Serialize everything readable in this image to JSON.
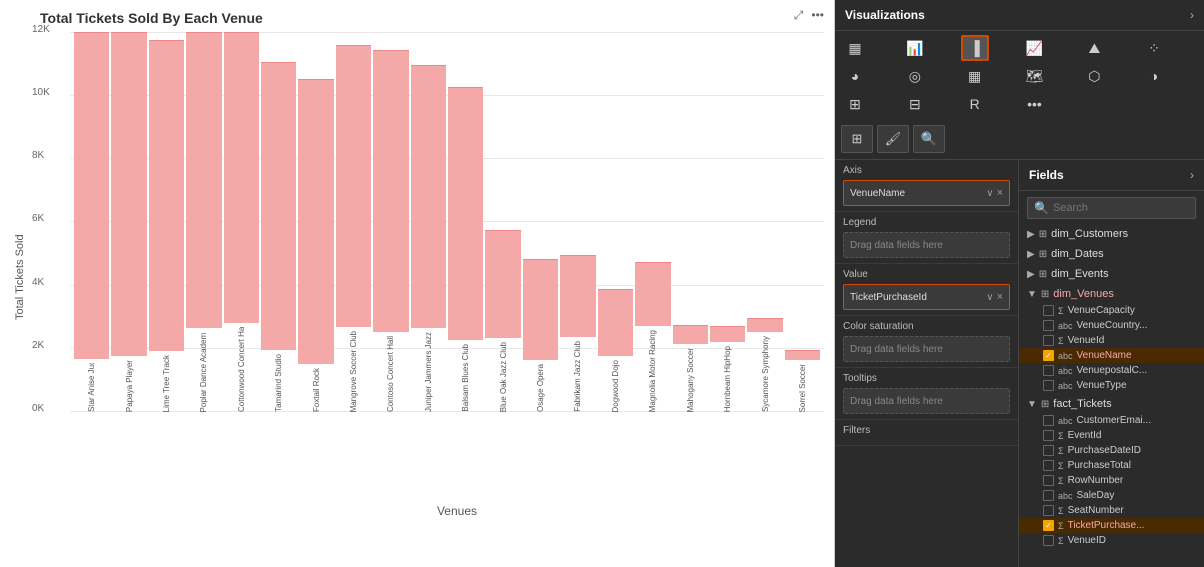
{
  "chart": {
    "title": "Total Tickets Sold By Each Venue",
    "y_label": "Total Tickets Sold",
    "x_label": "Venues",
    "y_ticks": [
      "12K",
      "10K",
      "8K",
      "6K",
      "4K",
      "2K",
      "0K"
    ],
    "bars": [
      {
        "label": "Star Anise Judo",
        "value": 11800
      },
      {
        "label": "Papaya Players",
        "value": 11000
      },
      {
        "label": "Lime Tree Track",
        "value": 9800
      },
      {
        "label": "Poplar Dance Academy",
        "value": 9700
      },
      {
        "label": "Cottonwood Concert Hall",
        "value": 9300
      },
      {
        "label": "Tamarind Studio",
        "value": 9100
      },
      {
        "label": "Foxtail Rock",
        "value": 9000
      },
      {
        "label": "Mangrove Soccer Club",
        "value": 8900
      },
      {
        "label": "Contoso Concert Hall",
        "value": 8900
      },
      {
        "label": "Juniper Jammers Jazz",
        "value": 8300
      },
      {
        "label": "Balsam Blues Club",
        "value": 8000
      },
      {
        "label": "Blue Oak Jazz Club",
        "value": 3400
      },
      {
        "label": "Osage Opera",
        "value": 3200
      },
      {
        "label": "Fabrikam Jazz Club",
        "value": 2600
      },
      {
        "label": "Dogwood Dojo",
        "value": 2100
      },
      {
        "label": "Magnolia Motor Racing",
        "value": 2000
      },
      {
        "label": "Mahogany Soccer",
        "value": 600
      },
      {
        "label": "Hornbeam HipHop",
        "value": 500
      },
      {
        "label": "Sycamore Symphony",
        "value": 450
      },
      {
        "label": "Sorrel Soccer",
        "value": 300
      }
    ],
    "max_value": 12000
  },
  "visualizations": {
    "title": "Visualizations",
    "expand_label": "›",
    "tools": [
      "grid-icon",
      "format-icon",
      "analytics-icon"
    ]
  },
  "viz_config": {
    "axis_label": "Axis",
    "axis_field": "VenueName",
    "legend_label": "Legend",
    "legend_placeholder": "Drag data fields here",
    "value_label": "Value",
    "value_field": "TicketPurchaseId",
    "color_saturation_label": "Color saturation",
    "color_saturation_placeholder": "Drag data fields here",
    "tooltips_label": "Tooltips",
    "tooltips_placeholder": "Drag data fields here",
    "filters_label": "Filters"
  },
  "fields": {
    "title": "Fields",
    "expand_label": "›",
    "search_placeholder": "Search",
    "groups": [
      {
        "name": "dim_Customers",
        "expanded": false,
        "active": false,
        "items": []
      },
      {
        "name": "dim_Dates",
        "expanded": false,
        "active": false,
        "items": []
      },
      {
        "name": "dim_Events",
        "expanded": false,
        "active": false,
        "items": []
      },
      {
        "name": "dim_Venues",
        "expanded": true,
        "active": true,
        "items": [
          {
            "name": "VenueCapacity",
            "checked": false,
            "type": "Σ"
          },
          {
            "name": "VenueCountry...",
            "checked": false,
            "type": "abc"
          },
          {
            "name": "VenueId",
            "checked": false,
            "type": "Σ"
          },
          {
            "name": "VenueName",
            "checked": true,
            "type": "abc",
            "highlighted": true
          },
          {
            "name": "VenuepostalC...",
            "checked": false,
            "type": "abc"
          },
          {
            "name": "VenueType",
            "checked": false,
            "type": "abc"
          }
        ]
      },
      {
        "name": "fact_Tickets",
        "expanded": true,
        "active": false,
        "items": [
          {
            "name": "CustomerEmai...",
            "checked": false,
            "type": "abc"
          },
          {
            "name": "EventId",
            "checked": false,
            "type": "Σ"
          },
          {
            "name": "PurchaseDateID",
            "checked": false,
            "type": "Σ"
          },
          {
            "name": "PurchaseTotal",
            "checked": false,
            "type": "Σ"
          },
          {
            "name": "RowNumber",
            "checked": false,
            "type": "Σ"
          },
          {
            "name": "SaleDay",
            "checked": false,
            "type": "abc"
          },
          {
            "name": "SeatNumber",
            "checked": false,
            "type": "Σ"
          },
          {
            "name": "TicketPurchase...",
            "checked": true,
            "type": "Σ",
            "highlighted": true
          },
          {
            "name": "VenueID",
            "checked": false,
            "type": "Σ"
          }
        ]
      }
    ]
  }
}
